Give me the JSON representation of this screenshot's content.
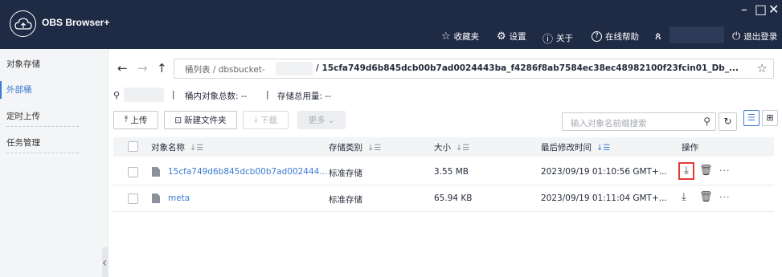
{
  "app": {
    "title": "OBS Browser+",
    "window_controls": {
      "minimize": "–",
      "maximize": "□",
      "close": "✕"
    },
    "menu": [
      {
        "icon": "star-icon",
        "glyph": "☆",
        "label": "收藏夹"
      },
      {
        "icon": "settings-icon",
        "glyph": "⚙",
        "label": "设置"
      },
      {
        "icon": "info-icon",
        "glyph": "ⓘ",
        "label": "关于"
      },
      {
        "icon": "help-icon",
        "glyph": "?",
        "label": "在线帮助"
      }
    ],
    "user_glyph": "ጰ",
    "logout_label": "退出登录"
  },
  "sidebar": {
    "items": [
      {
        "label": "对象存储"
      },
      {
        "label": "外部桶"
      },
      {
        "label": "定时上传"
      },
      {
        "label": "任务管理"
      }
    ]
  },
  "address": {
    "root": "桶列表 / dbsbucket-",
    "path": "/ 15cfa749d6b845dcb00b7ad0024443ba_f4286f8ab7584ec38ec48982100f23fcin01_Db_..."
  },
  "info": {
    "object_count_label": "桶内对象总数: --",
    "storage_used_label": "存储总用量: --",
    "separator": "|"
  },
  "toolbar": {
    "upload": "上传",
    "new_folder": "新建文件夹",
    "download": "下载",
    "more": "更多"
  },
  "search": {
    "placeholder": "输入对象名前缀搜索"
  },
  "table": {
    "headers": {
      "name": "对象名称",
      "storage_class": "存储类别",
      "size": "大小",
      "modified": "最后修改时间",
      "actions": "操作"
    },
    "rows": [
      {
        "name": "15cfa749d6b845dcb00b7ad002444...",
        "storage_class": "标准存储",
        "size": "3.55 MB",
        "modified": "2023/09/19 01:10:56 GMT+..."
      },
      {
        "name": "meta",
        "storage_class": "标准存储",
        "size": "65.94 KB",
        "modified": "2023/09/19 01:11:04 GMT+..."
      }
    ]
  },
  "colors": {
    "title_bar": "#1f2a44",
    "accent": "#3b7bd4",
    "highlight": "#e53935"
  }
}
